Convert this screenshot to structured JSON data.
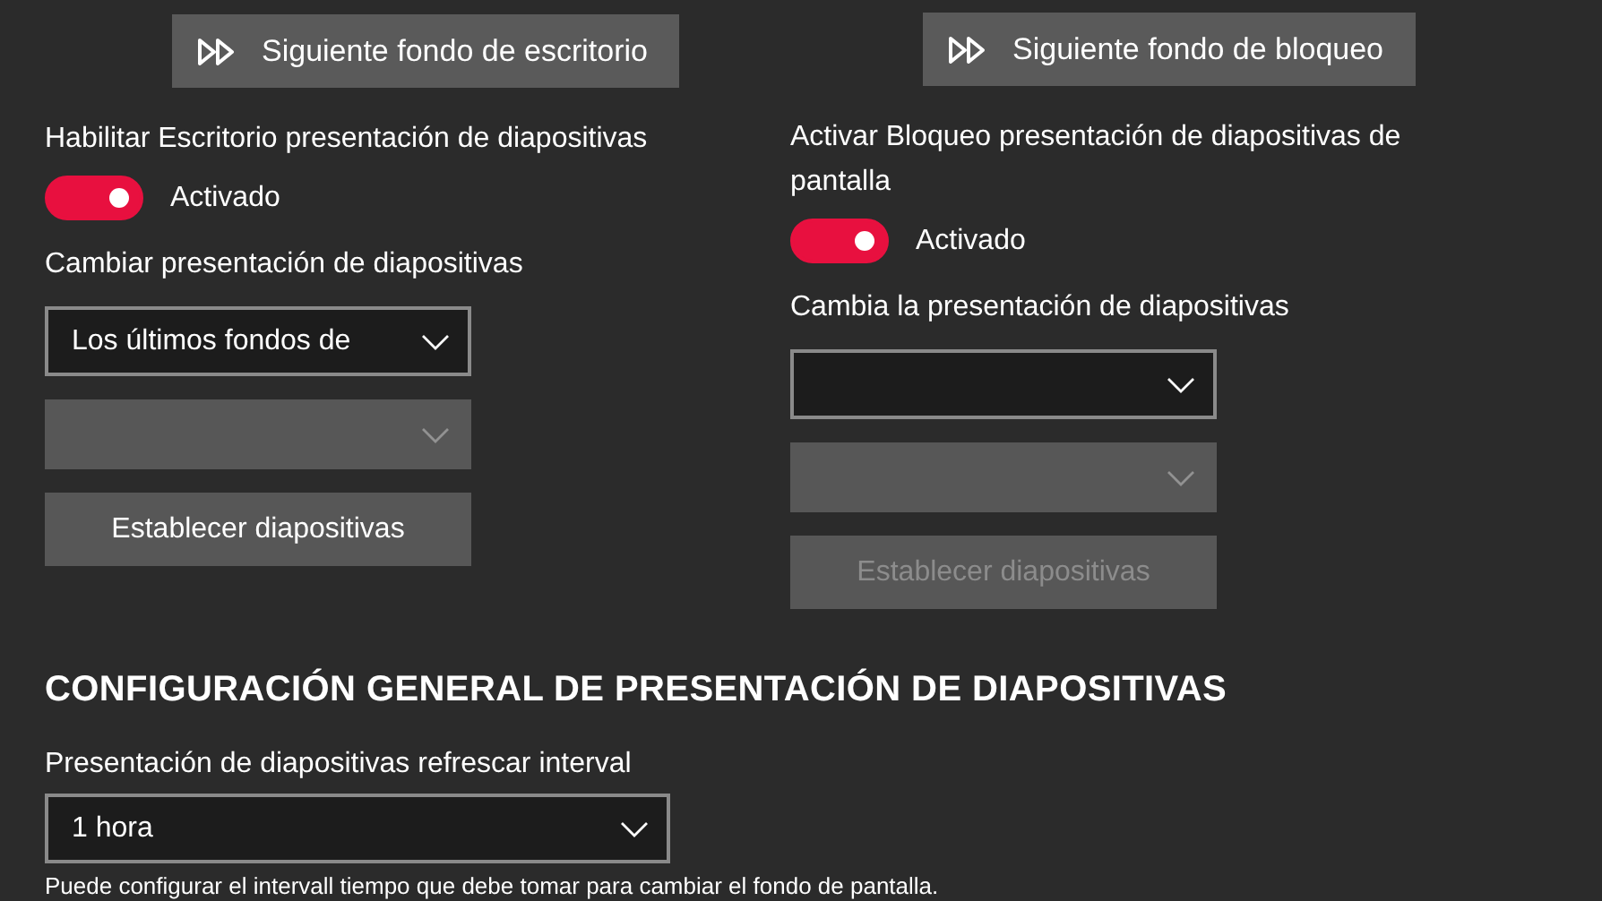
{
  "columns": [
    {
      "next_button": {
        "label": "Siguiente fondo de escritorio"
      },
      "toggle_label": "Habilitar Escritorio presentación de diapositivas",
      "toggle": {
        "on": true,
        "label": "Activado"
      },
      "dropdown_label": "Cambiar presentación de diapositivas",
      "dropdown": {
        "value": "Los últimos fondos de",
        "disabled": false
      },
      "secondary_dropdown": {
        "disabled": true
      },
      "set_button": {
        "label": "Establecer diapositivas",
        "disabled": false
      }
    },
    {
      "next_button": {
        "label": "Siguiente fondo de bloqueo"
      },
      "toggle_label": "Activar Bloqueo presentación de diapositivas de pantalla",
      "toggle": {
        "on": true,
        "label": "Activado"
      },
      "dropdown_label": "Cambia la presentación de diapositivas",
      "dropdown": {
        "disabled": false
      },
      "secondary_dropdown": {
        "disabled": true
      },
      "set_button": {
        "label": "Establecer diapositivas",
        "disabled": true
      }
    }
  ],
  "general": {
    "heading": "CONFIGURACIÓN GENERAL DE PRESENTACIÓN DE DIAPOSITIVAS",
    "interval_label": "Presentación de diapositivas refrescar interval",
    "interval_dropdown": {
      "value": "1 hora",
      "disabled": false
    },
    "hint": "Puede configurar el intervall tiempo que debe tomar para cambiar el fondo de pantalla."
  }
}
